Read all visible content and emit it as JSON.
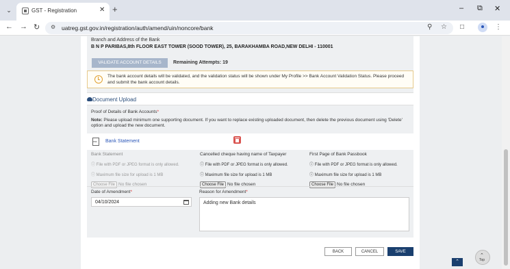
{
  "browser": {
    "tab_title": "GST - Registration",
    "url": "uatreg.gst.gov.in/registration/auth/amend/uin/noncore/bank"
  },
  "bank": {
    "address_label": "Branch and Address of the Bank",
    "address_value": "B N P PARIBAS,8th FLOOR EAST TOWER (SOOD TOWER), 25, BARAKHAMBA ROAD,NEW DELHI - 110001",
    "validate_label": "VALIDATE ACCOUNT DETAILS",
    "remaining_attempts": "Remaining Attempts: 19",
    "info_text": "The bank account details will be validated, and the validation status will be shown under My Profile >> Bank Account Validation Status. Please proceed and submit the bank account details."
  },
  "documents": {
    "section_title": "Document Upload",
    "proof_label": "Proof of Details of Bank Accounts",
    "note_bold": "Note:",
    "note_text": "Please upload minimum one supporting document. If you want to replace existing uploaded document, then delete the previous document using 'Delete' option and upload the new document.",
    "uploaded_file": "Bank Statement",
    "columns": [
      {
        "title": "Bank Statement",
        "info1": "File with PDF or JPEG format is only allowed.",
        "info2": "Maximum file size for upload is 1 MB",
        "button": "Choose File",
        "status": "No file chosen"
      },
      {
        "title": "Cancelled cheque having name of Taxpayer",
        "info1": "File with PDF or JPEG format is only allowed.",
        "info2": "Maximum file size for upload is 1 MB",
        "button": "Choose File",
        "status": "No file chosen"
      },
      {
        "title": "First Page of Bank Passbook",
        "info1": "File with PDF or JPEG format is only allowed.",
        "info2": "Maximum file size for upload is 1 MB",
        "button": "Choose File",
        "status": "No file chosen"
      }
    ]
  },
  "amendment": {
    "date_label": "Date of Amendment",
    "date_value": "04/10/2024",
    "reason_label": "Reason for Amendment",
    "reason_value": "Adding new Bank details"
  },
  "actions": {
    "back": "BACK",
    "cancel": "CANCEL",
    "save": "SAVE",
    "top": "Top"
  }
}
